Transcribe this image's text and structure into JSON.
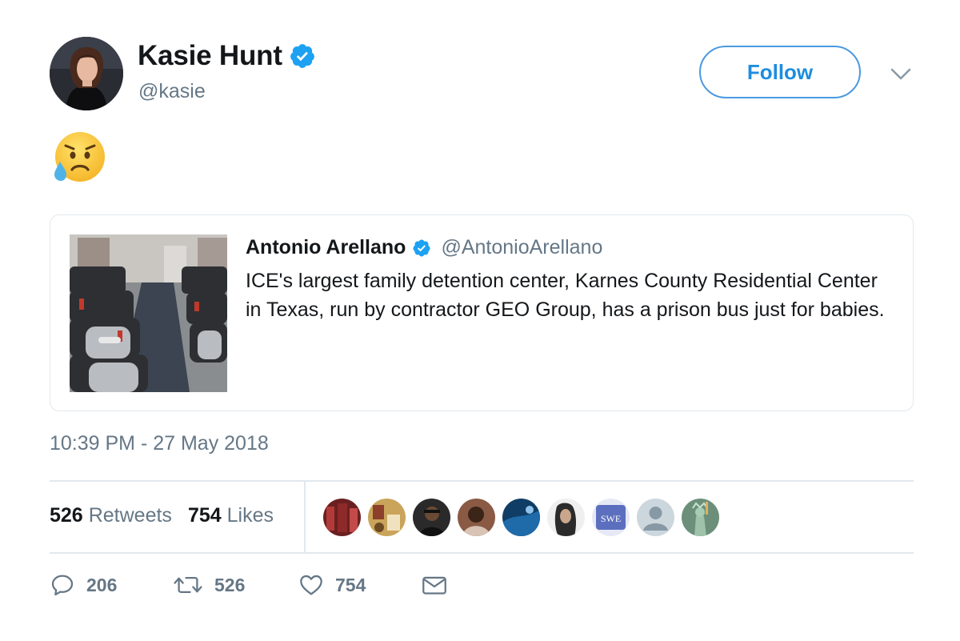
{
  "tweet": {
    "author": {
      "display_name": "Kasie Hunt",
      "handle": "@kasie",
      "verified": true,
      "avatar_icon": "avatar-photo"
    },
    "follow_label": "Follow",
    "menu_icon": "chevron-down-icon",
    "body_emoji": "disappointed-but-relieved-face-emoji",
    "timestamp": "10:39 PM - 27 May 2018"
  },
  "quoted_tweet": {
    "display_name": "Antonio Arellano",
    "handle": "@AntonioArellano",
    "verified": true,
    "text": "ICE's largest family detention center, Karnes County Residential Center in Texas, run by contractor GEO Group, has a prison bus just for babies.",
    "thumbnail_icon": "bus-car-seats-photo"
  },
  "stats": {
    "retweets_count": "526",
    "retweets_label": "Retweets",
    "likes_count": "754",
    "likes_label": "Likes"
  },
  "likers": [
    {
      "name": "liker-avatar-1",
      "color": "#8a2d2d"
    },
    {
      "name": "liker-avatar-2",
      "color": "#b8893a"
    },
    {
      "name": "liker-avatar-3",
      "color": "#2b2b2b"
    },
    {
      "name": "liker-avatar-4",
      "color": "#7a4a36"
    },
    {
      "name": "liker-avatar-5",
      "color": "#1f5a8c"
    },
    {
      "name": "liker-avatar-6",
      "color": "#d9d9d9"
    },
    {
      "name": "liker-avatar-7",
      "color": "#5c6fbf",
      "text": "SWE"
    },
    {
      "name": "liker-avatar-8",
      "color": "#c8ccd0"
    },
    {
      "name": "liker-avatar-9",
      "color": "#5f8a6d"
    }
  ],
  "actions": {
    "reply_count": "206",
    "retweet_count": "526",
    "like_count": "754"
  },
  "colors": {
    "accent": "#1da1f2",
    "text_primary": "#14171a",
    "text_secondary": "#657786",
    "border": "#e1e8ed"
  }
}
